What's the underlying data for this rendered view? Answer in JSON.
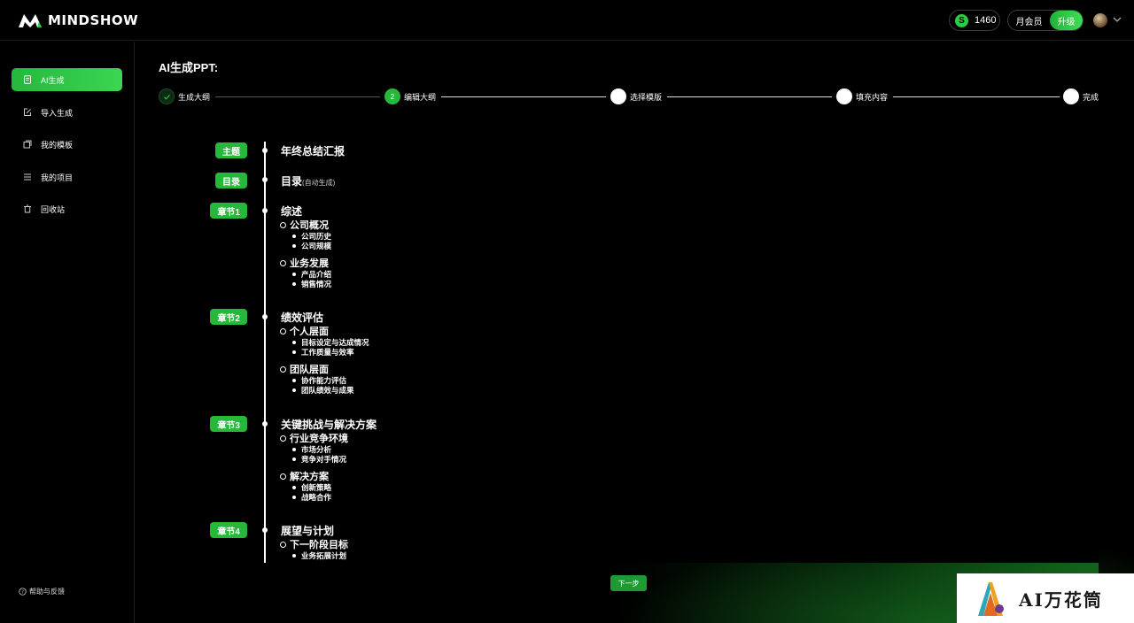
{
  "header": {
    "logo_text": "MINDSHOW",
    "coins": "1460",
    "coin_symbol": "S",
    "member_label": "月会员",
    "upgrade_label": "升级"
  },
  "sidebar": {
    "items": [
      {
        "label": "AI生成",
        "icon": "ai-doc-icon",
        "active": true
      },
      {
        "label": "导入生成",
        "icon": "import-icon",
        "active": false
      },
      {
        "label": "我的模板",
        "icon": "template-icon",
        "active": false
      },
      {
        "label": "我的项目",
        "icon": "list-icon",
        "active": false
      },
      {
        "label": "回收站",
        "icon": "trash-icon",
        "active": false
      }
    ],
    "help_label": "帮助与反馈"
  },
  "main": {
    "title": "AI生成PPT:",
    "steps": [
      {
        "label": "生成大纲",
        "state": "done"
      },
      {
        "label": "编辑大纲",
        "state": "current",
        "number": "2"
      },
      {
        "label": "选择模版",
        "state": "todo"
      },
      {
        "label": "填充内容",
        "state": "todo"
      },
      {
        "label": "完成",
        "state": "todo"
      }
    ],
    "outline": {
      "topic_tag": "主题",
      "topic": "年终总结汇报",
      "toc_tag": "目录",
      "toc": "目录",
      "toc_note": "(自动生成)",
      "chapters": [
        {
          "tag": "章节1",
          "title": "综述",
          "subs": [
            {
              "title": "公司概况",
              "leaves": [
                "公司历史",
                "公司规模"
              ]
            },
            {
              "title": "业务发展",
              "leaves": [
                "产品介绍",
                "销售情况"
              ]
            }
          ]
        },
        {
          "tag": "章节2",
          "title": "绩效评估",
          "subs": [
            {
              "title": "个人层面",
              "leaves": [
                "目标设定与达成情况",
                "工作质量与效率"
              ]
            },
            {
              "title": "团队层面",
              "leaves": [
                "协作能力评估",
                "团队绩效与成果"
              ]
            }
          ]
        },
        {
          "tag": "章节3",
          "title": "关键挑战与解决方案",
          "subs": [
            {
              "title": "行业竞争环境",
              "leaves": [
                "市场分析",
                "竞争对手情况"
              ]
            },
            {
              "title": "解决方案",
              "leaves": [
                "创新策略",
                "战略合作"
              ]
            }
          ]
        },
        {
          "tag": "章节4",
          "title": "展望与计划",
          "subs": [
            {
              "title": "下一阶段目标",
              "leaves": [
                "业务拓展计划"
              ]
            }
          ]
        }
      ]
    },
    "next_label": "下一步"
  },
  "watermark": {
    "text": "AI万花筒"
  },
  "colors": {
    "accent": "#25b83b",
    "background": "#000000"
  }
}
